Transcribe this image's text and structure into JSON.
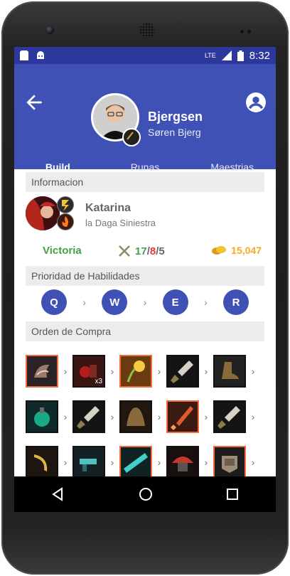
{
  "status": {
    "network": "LTE",
    "time": "8:32"
  },
  "profile": {
    "name": "Bjergsen",
    "real_name": "Søren Bjerg"
  },
  "tabs": [
    {
      "label": "Build",
      "active": true
    },
    {
      "label": "Runas",
      "active": false
    },
    {
      "label": "Maestrias",
      "active": false
    }
  ],
  "info": {
    "header": "Informacion",
    "champion": {
      "name": "Katarina",
      "title": "la Daga Siniestra"
    },
    "result": "Victoria",
    "kda": {
      "k": "17",
      "d": "8",
      "a": "5"
    },
    "gold": "15,047"
  },
  "skills": {
    "header": "Prioridad de Habilidades",
    "order": [
      "Q",
      "W",
      "E",
      "R"
    ]
  },
  "items": {
    "header": "Orden de Compra",
    "rows": [
      [
        {
          "icon": "helm-item-icon",
          "hl": true,
          "qty": ""
        },
        {
          "icon": "potion-pack-icon",
          "hl": false,
          "qty": "x3"
        },
        {
          "icon": "seed-item-icon",
          "hl": true,
          "qty": ""
        },
        {
          "icon": "long-sword-icon",
          "hl": false,
          "qty": ""
        },
        {
          "icon": "boots-icon",
          "hl": false,
          "qty": ""
        }
      ],
      [
        {
          "icon": "green-potion-icon",
          "hl": false,
          "qty": ""
        },
        {
          "icon": "long-sword-icon",
          "hl": false,
          "qty": ""
        },
        {
          "icon": "cloak-icon",
          "hl": false,
          "qty": ""
        },
        {
          "icon": "crimson-blade-icon",
          "hl": true,
          "qty": ""
        },
        {
          "icon": "long-sword-icon",
          "hl": false,
          "qty": ""
        }
      ],
      [
        {
          "icon": "dagger-icon",
          "hl": false,
          "qty": ""
        },
        {
          "icon": "pistol-icon",
          "hl": false,
          "qty": ""
        },
        {
          "icon": "gunblade-icon",
          "hl": true,
          "qty": ""
        },
        {
          "icon": "red-hat-icon",
          "hl": false,
          "qty": ""
        },
        {
          "icon": "armor-icon",
          "hl": true,
          "qty": ""
        }
      ]
    ]
  },
  "colors": {
    "primary": "#3f51b5",
    "status_bar": "#2d389c",
    "win": "#43a047",
    "death": "#e53935",
    "gold": "#f9a825",
    "highlight": "#ef6c3a"
  }
}
